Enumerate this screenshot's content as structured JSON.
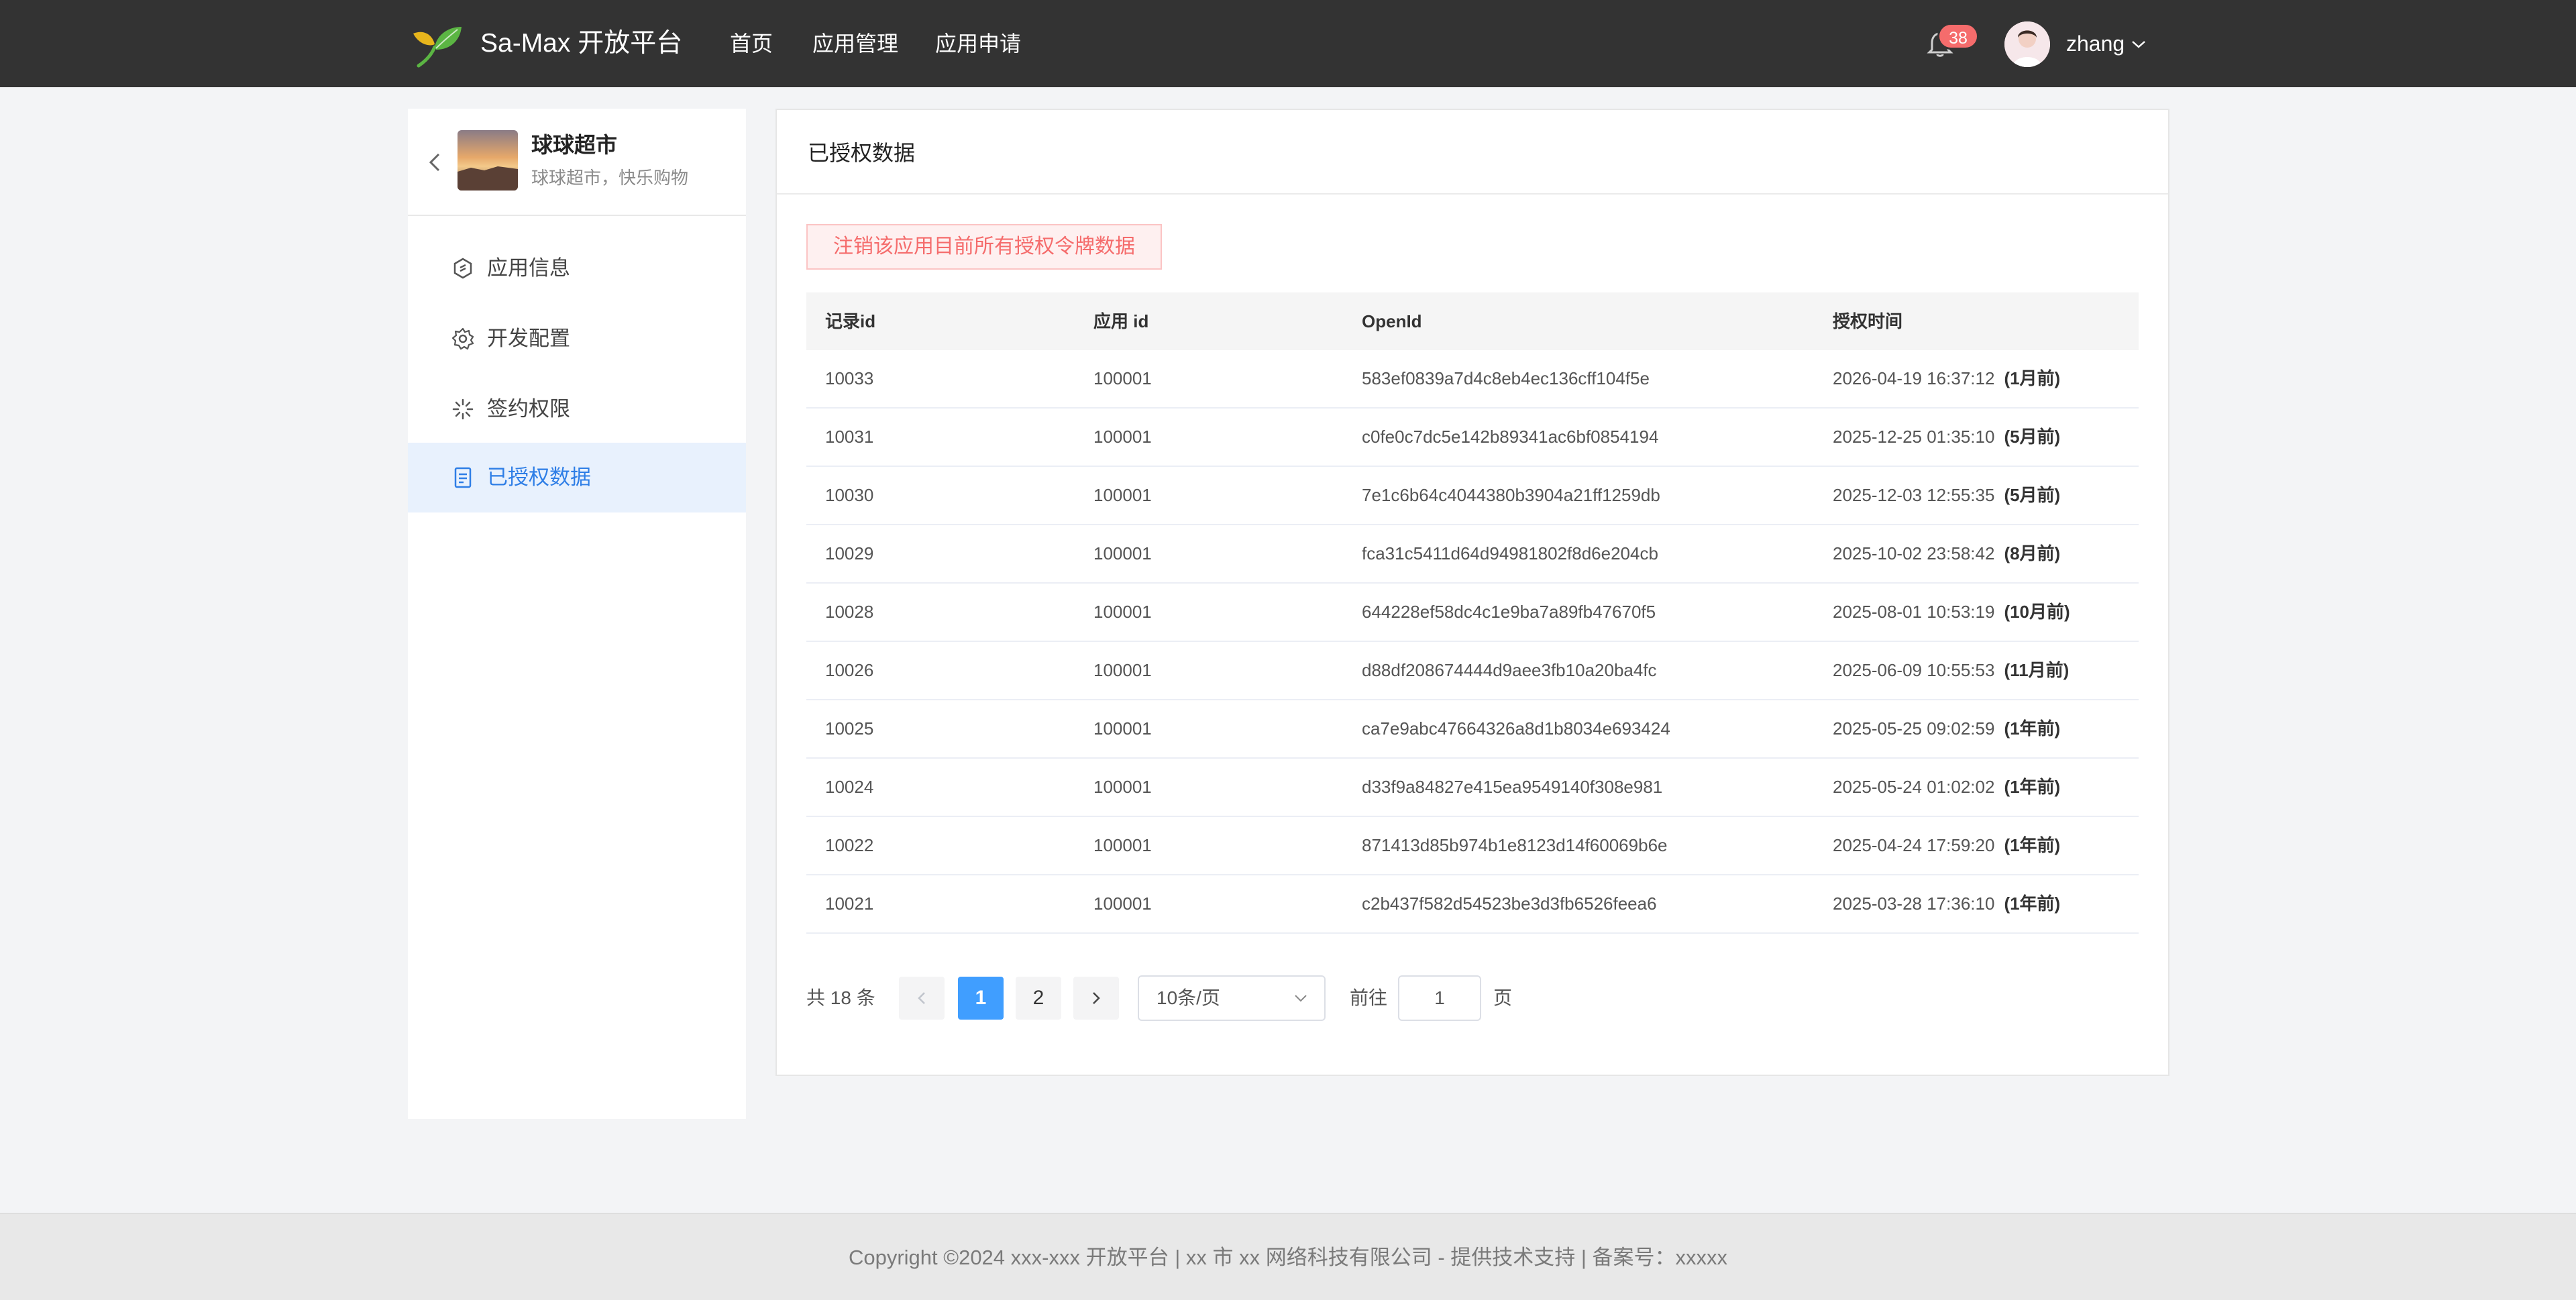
{
  "header": {
    "brand": "Sa-Max 开放平台",
    "nav": [
      "首页",
      "应用管理",
      "应用申请"
    ],
    "notification_count": "38",
    "username": "zhang"
  },
  "sidebar": {
    "app_name": "球球超市",
    "app_desc": "球球超市，快乐购物",
    "menu": [
      {
        "label": "应用信息",
        "icon": "app-info-icon"
      },
      {
        "label": "开发配置",
        "icon": "gear-icon"
      },
      {
        "label": "签约权限",
        "icon": "loading-icon"
      },
      {
        "label": "已授权数据",
        "icon": "document-icon"
      }
    ],
    "active_index": 3
  },
  "main": {
    "title": "已授权数据",
    "revoke_button": "注销该应用目前所有授权令牌数据",
    "columns": [
      "记录id",
      "应用 id",
      "OpenId",
      "授权时间"
    ],
    "rows": [
      {
        "id": "10033",
        "app_id": "100001",
        "openid": "583ef0839a7d4c8eb4ec136cff104f5e",
        "time": "2026-04-19 16:37:12",
        "relative": "(1月前)"
      },
      {
        "id": "10031",
        "app_id": "100001",
        "openid": "c0fe0c7dc5e142b89341ac6bf0854194",
        "time": "2025-12-25 01:35:10",
        "relative": "(5月前)"
      },
      {
        "id": "10030",
        "app_id": "100001",
        "openid": "7e1c6b64c4044380b3904a21ff1259db",
        "time": "2025-12-03 12:55:35",
        "relative": "(5月前)"
      },
      {
        "id": "10029",
        "app_id": "100001",
        "openid": "fca31c5411d64d94981802f8d6e204cb",
        "time": "2025-10-02 23:58:42",
        "relative": "(8月前)"
      },
      {
        "id": "10028",
        "app_id": "100001",
        "openid": "644228ef58dc4c1e9ba7a89fb47670f5",
        "time": "2025-08-01 10:53:19",
        "relative": "(10月前)"
      },
      {
        "id": "10026",
        "app_id": "100001",
        "openid": "d88df208674444d9aee3fb10a20ba4fc",
        "time": "2025-06-09 10:55:53",
        "relative": "(11月前)"
      },
      {
        "id": "10025",
        "app_id": "100001",
        "openid": "ca7e9abc47664326a8d1b8034e693424",
        "time": "2025-05-25 09:02:59",
        "relative": "(1年前)"
      },
      {
        "id": "10024",
        "app_id": "100001",
        "openid": "d33f9a84827e415ea9549140f308e981",
        "time": "2025-05-24 01:02:02",
        "relative": "(1年前)"
      },
      {
        "id": "10022",
        "app_id": "100001",
        "openid": "871413d85b974b1e8123d14f60069b6e",
        "time": "2025-04-24 17:59:20",
        "relative": "(1年前)"
      },
      {
        "id": "10021",
        "app_id": "100001",
        "openid": "c2b437f582d54523be3d3fb6526feea6",
        "time": "2025-03-28 17:36:10",
        "relative": "(1年前)"
      }
    ],
    "pagination": {
      "total_text": "共 18 条",
      "pages": [
        "1",
        "2"
      ],
      "current_page": "1",
      "page_size": "10条/页",
      "goto_label": "前往",
      "goto_value": "1",
      "goto_unit": "页"
    }
  },
  "footer": {
    "text": "Copyright ©2024 xxx-xxx 开放平台 | xx 市 xx 网络科技有限公司 - 提供技术支持 | 备案号：xxxxx"
  },
  "colors": {
    "header_bg": "#333333",
    "accent": "#409eff",
    "danger": "#f56c6c",
    "active_menu_bg": "#e8f1fd"
  }
}
